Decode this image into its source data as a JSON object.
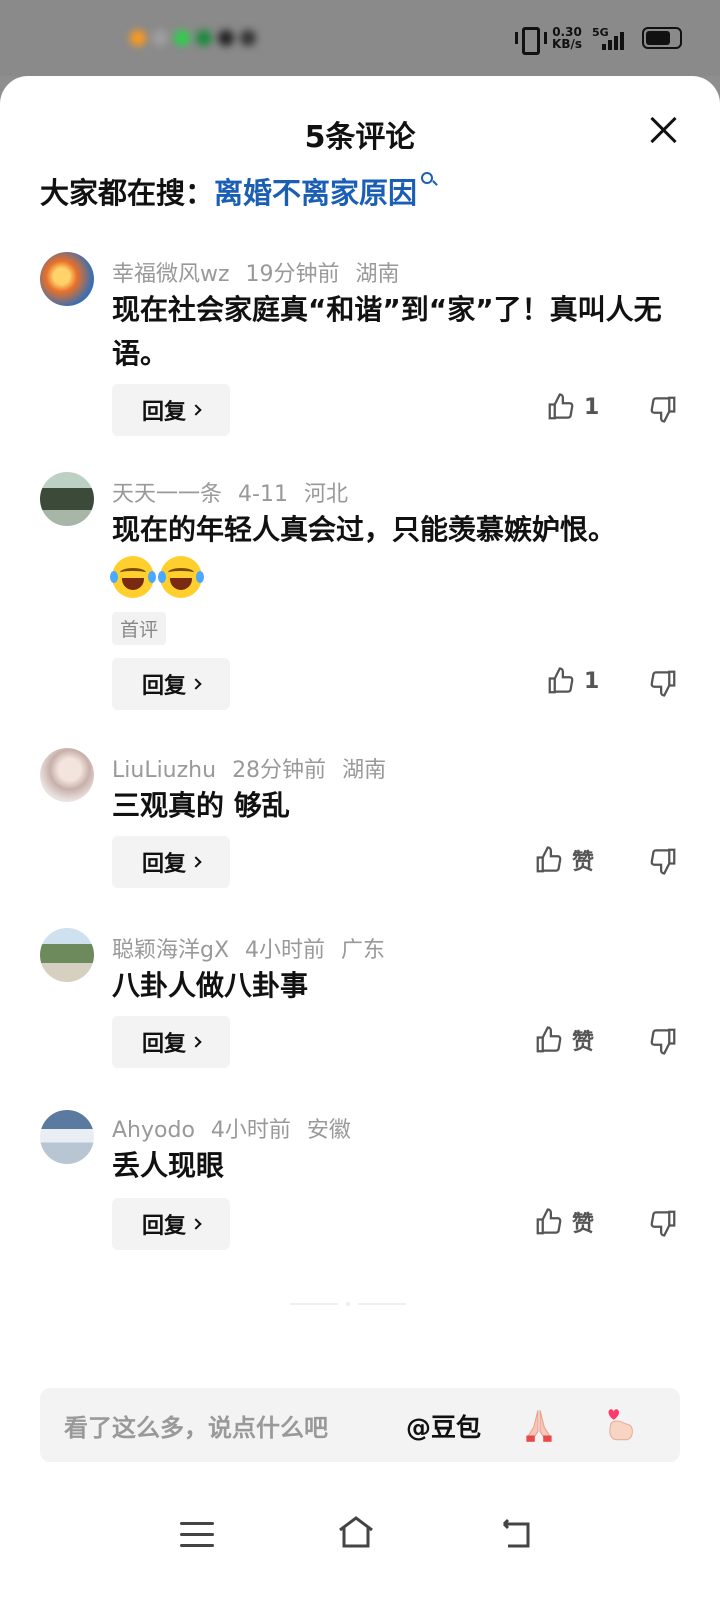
{
  "status_bar": {
    "speed_value": "0.30",
    "speed_unit": "KB/s",
    "network": "5G"
  },
  "header": {
    "title": "5条评论"
  },
  "search": {
    "label": "大家都在搜：",
    "term": "离婚不离家原因"
  },
  "comments": [
    {
      "user": "幸福微风wz",
      "time": "19分钟前",
      "location": "湖南",
      "text": "现在社会家庭真“和谐”到“家”了！真叫人无语。",
      "reply_label": "回复",
      "likes": "1"
    },
    {
      "user": "天天一一条",
      "time": "4-11",
      "location": "河北",
      "text": "现在的年轻人真会过，只能羡慕嫉妒恨。",
      "badge": "首评",
      "reply_label": "回复",
      "likes": "1"
    },
    {
      "user": "LiuLiuzhu",
      "time": "28分钟前",
      "location": "湖南",
      "text": "三观真的 够乱",
      "reply_label": "回复",
      "likes": "赞"
    },
    {
      "user": "聪颖海洋gX",
      "time": "4小时前",
      "location": "广东",
      "text": "八卦人做八卦事",
      "reply_label": "回复",
      "likes": "赞"
    },
    {
      "user": "Ahyodo",
      "time": "4小时前",
      "location": "安徽",
      "text": "丢人现眼",
      "reply_label": "回复",
      "likes": "赞"
    }
  ],
  "input": {
    "placeholder": "看了这么多，说点什么吧",
    "mention": "@豆包"
  },
  "colors": {
    "link": "#1a5fb4",
    "meta": "#999999",
    "button_bg": "#f3f3f3"
  },
  "icons": [
    "close-icon",
    "search-icon",
    "like-icon",
    "dislike-icon",
    "pray-emoji-icon",
    "finger-heart-icon",
    "menu-icon",
    "home-icon",
    "back-icon"
  ]
}
